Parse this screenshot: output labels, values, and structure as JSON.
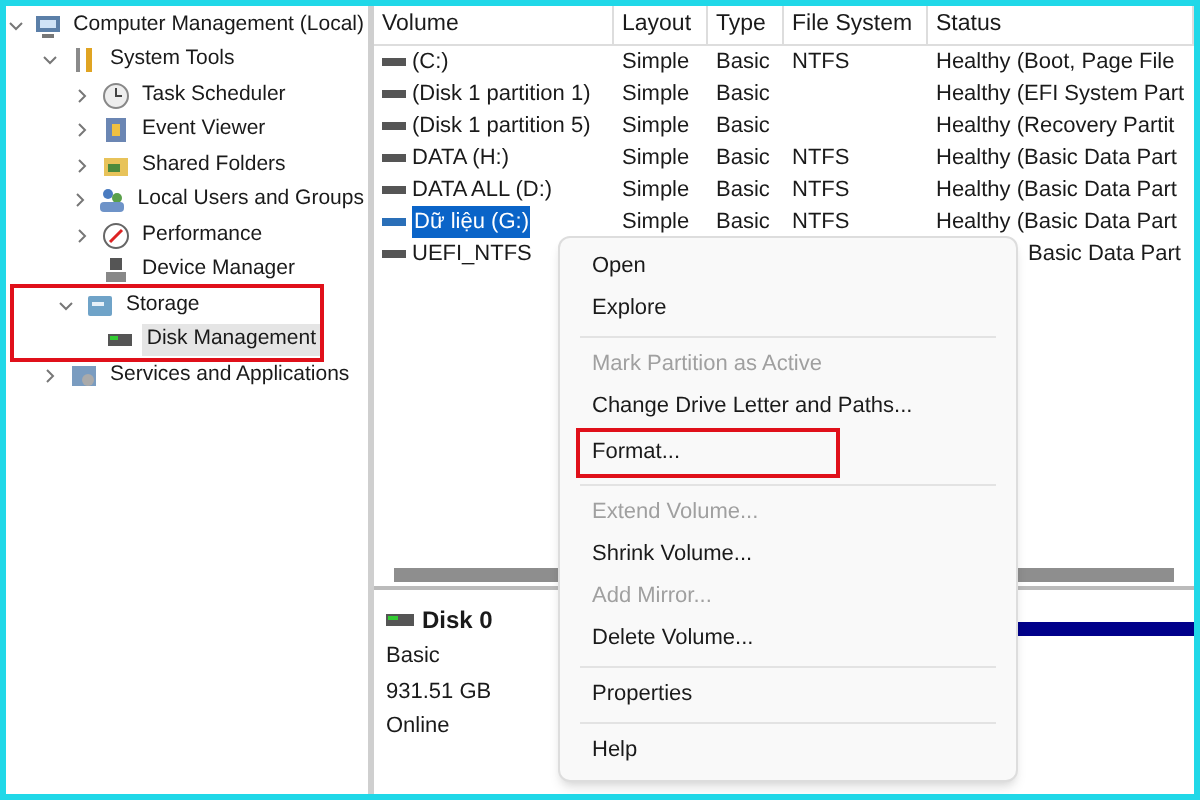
{
  "tree": {
    "label": "Computer Management (Local)",
    "expanded": true,
    "children": [
      {
        "label": "System Tools",
        "expanded": true,
        "children": [
          {
            "label": "Task Scheduler",
            "expanded": false
          },
          {
            "label": "Event Viewer",
            "expanded": false
          },
          {
            "label": "Shared Folders",
            "expanded": false
          },
          {
            "label": "Local Users and Groups",
            "expanded": false
          },
          {
            "label": "Performance",
            "expanded": false
          },
          {
            "label": "Device Manager"
          }
        ]
      },
      {
        "label": "Storage",
        "expanded": true,
        "highlighted": true,
        "children": [
          {
            "label": "Disk Management",
            "selected": true
          }
        ]
      },
      {
        "label": "Services and Applications",
        "expanded": false
      }
    ]
  },
  "table": {
    "columns": [
      "Volume",
      "Layout",
      "Type",
      "File System",
      "Status"
    ],
    "rows": [
      {
        "cells": [
          "(C:)",
          "Simple",
          "Basic",
          "NTFS",
          "Healthy (Boot, Page File"
        ],
        "selected": false
      },
      {
        "cells": [
          "(Disk 1 partition 1)",
          "Simple",
          "Basic",
          "",
          "Healthy (EFI System Part"
        ],
        "selected": false
      },
      {
        "cells": [
          "(Disk 1 partition 5)",
          "Simple",
          "Basic",
          "",
          "Healthy (Recovery Partit"
        ],
        "selected": false
      },
      {
        "cells": [
          "DATA (H:)",
          "Simple",
          "Basic",
          "NTFS",
          "Healthy (Basic Data Part"
        ],
        "selected": false
      },
      {
        "cells": [
          "DATA ALL (D:)",
          "Simple",
          "Basic",
          "NTFS",
          "Healthy (Basic Data Part"
        ],
        "selected": false
      },
      {
        "cells": [
          "Dữ liệu (G:)",
          "Simple",
          "Basic",
          "NTFS",
          "Healthy (Basic Data Part"
        ],
        "selected": true
      },
      {
        "cells": [
          "UEFI_NTFS",
          "",
          "",
          "",
          "Basic Data Part"
        ],
        "selected": false
      }
    ]
  },
  "disk": {
    "name": "Disk 0",
    "type": "Basic",
    "size": "931.51 GB",
    "state": "Online"
  },
  "context_menu": [
    {
      "kind": "item",
      "label": "Open",
      "disabled": false
    },
    {
      "kind": "item",
      "label": "Explore",
      "disabled": false
    },
    {
      "kind": "separator"
    },
    {
      "kind": "item",
      "label": "Mark Partition as Active",
      "disabled": true
    },
    {
      "kind": "item",
      "label": "Change Drive Letter and Paths...",
      "disabled": false
    },
    {
      "kind": "item",
      "label": "Format...",
      "disabled": false,
      "highlighted": true
    },
    {
      "kind": "separator"
    },
    {
      "kind": "item",
      "label": "Extend Volume...",
      "disabled": true
    },
    {
      "kind": "item",
      "label": "Shrink Volume...",
      "disabled": false
    },
    {
      "kind": "item",
      "label": "Add Mirror...",
      "disabled": true
    },
    {
      "kind": "item",
      "label": "Delete Volume...",
      "disabled": false
    },
    {
      "kind": "separator"
    },
    {
      "kind": "item",
      "label": "Properties",
      "disabled": false
    },
    {
      "kind": "separator"
    },
    {
      "kind": "item",
      "label": "Help",
      "disabled": false
    }
  ]
}
